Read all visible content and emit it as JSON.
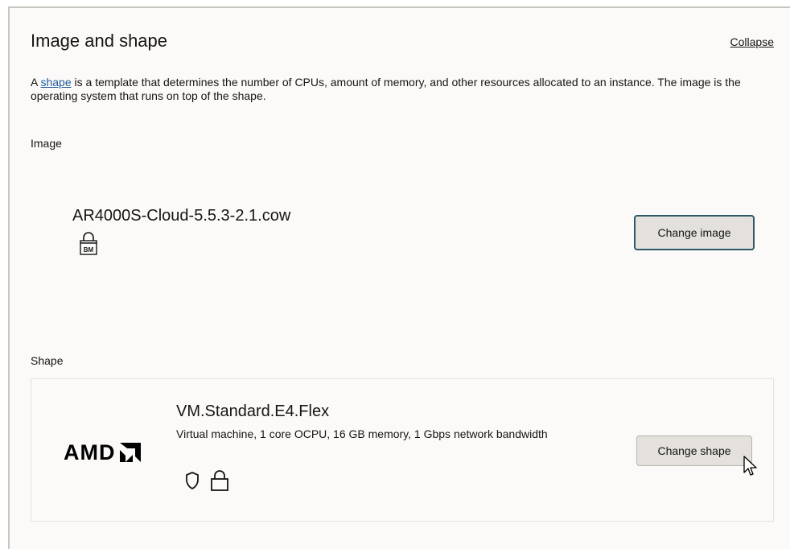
{
  "section": {
    "title": "Image and shape",
    "collapse_label": "Collapse",
    "description_prefix": "A ",
    "description_link": "shape",
    "description_suffix": " is a template that determines the number of CPUs, amount of memory, and other resources allocated to an instance. The image is the operating system that runs on top of the shape."
  },
  "image": {
    "label": "Image",
    "name": "AR4000S-Cloud-5.5.3-2.1.cow",
    "badge_text": "BM",
    "badge_icon": "lock-bm-icon",
    "change_button_label": "Change image"
  },
  "shape": {
    "label": "Shape",
    "vendor_logo_text": "AMD",
    "vendor_icon": "amd-logo",
    "name": "VM.Standard.E4.Flex",
    "description": "Virtual machine, 1 core OCPU, 16 GB memory, 1 Gbps network bandwidth",
    "icons": [
      "shield-icon",
      "lock-icon"
    ],
    "change_button_label": "Change shape"
  },
  "colors": {
    "link": "#1f5b9b",
    "button_bg": "#e4e1dd",
    "focus_border": "#2c5967",
    "panel_bg": "#fbfaf9"
  }
}
